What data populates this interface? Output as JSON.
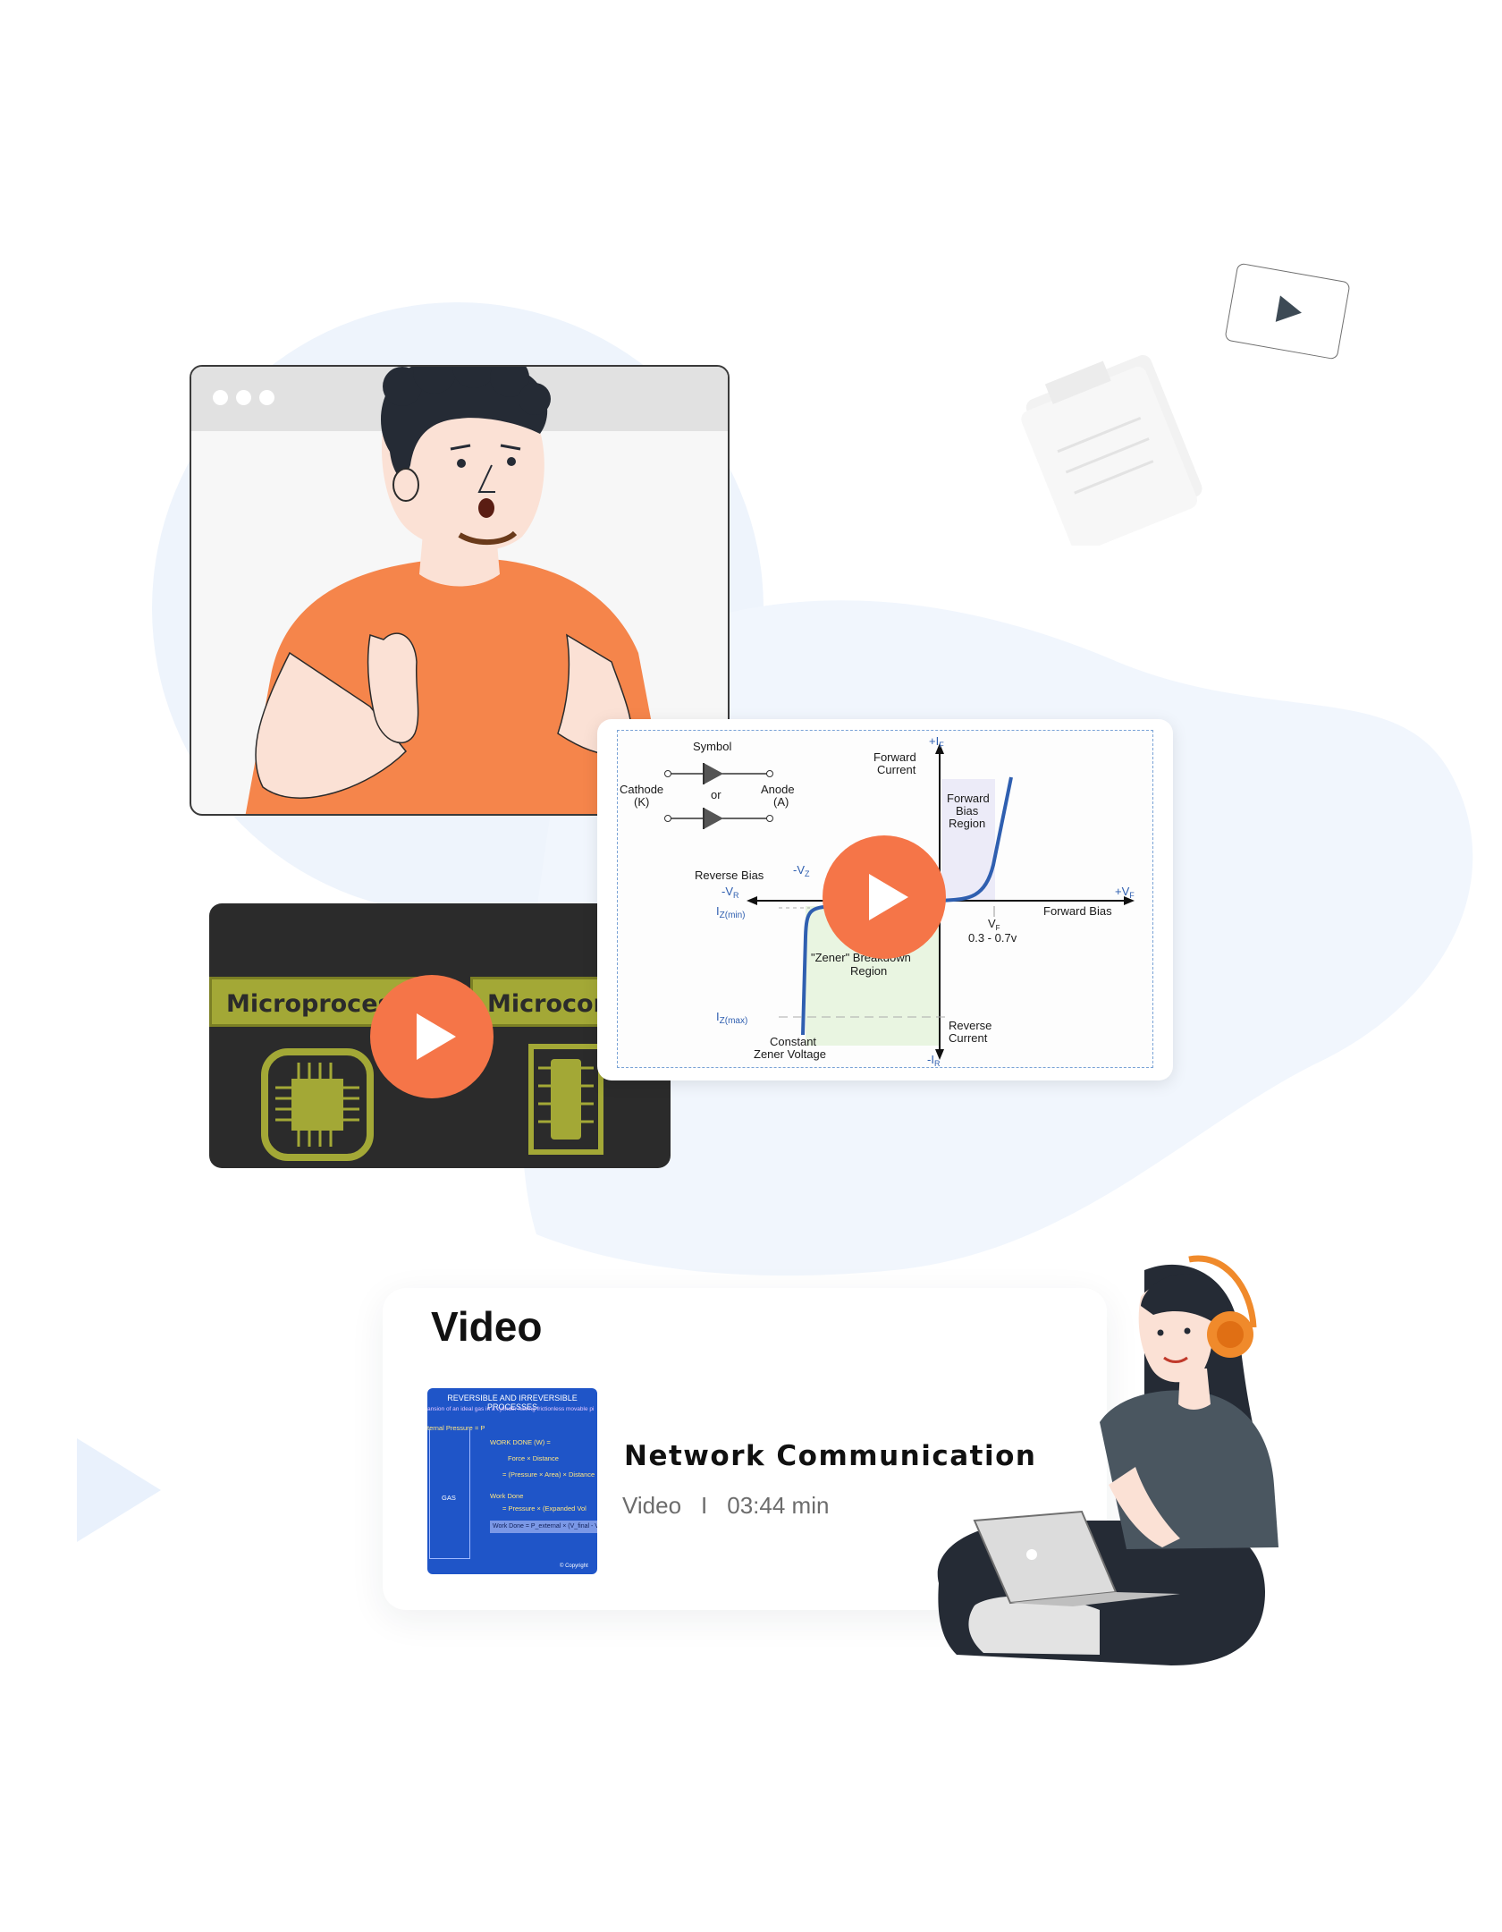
{
  "colors": {
    "accent": "#f57548",
    "blob": "#eef4fc",
    "dark_card": "#2b2b2b",
    "chip_green": "#a3a836",
    "thumbnail_blue": "#1f55c8"
  },
  "icons": {
    "play": "play-icon",
    "chip": "microchip-icon",
    "teacher": "teacher-illustration",
    "student": "student-with-headphones-illustration"
  },
  "dark_card": {
    "label_left": "Microprocess",
    "label_right": "Microcont"
  },
  "diagram": {
    "symbol": "Symbol",
    "or": "or",
    "cathode": "Cathode",
    "cathode_k": "(K)",
    "anode": "Anode",
    "anode_a": "(A)",
    "forward_current_1": "Forward",
    "forward_current_2": "Current",
    "plus_if": "+I",
    "plus_if_sub": "F",
    "forward_bias_region_1": "Forward",
    "forward_bias_region_2": "Bias",
    "forward_bias_region_3": "Region",
    "reverse_bias": "Reverse Bias",
    "minus_vr": "-V",
    "minus_vr_sub": "R",
    "minus_vz": "-V",
    "minus_vz_sub": "Z",
    "plus_vf": "+V",
    "plus_vf_sub": "F",
    "forward_bias": "Forward Bias",
    "iz_min": "I",
    "iz_min_sub": "Z(min)",
    "vf": "V",
    "vf_sub": "F",
    "vf_range": "0.3 - 0.7v",
    "zener_1": "\"Zener\" Breakdown",
    "zener_2": "Region",
    "iz_max": "I",
    "iz_max_sub": "Z(max)",
    "reverse_current_1": "Reverse",
    "reverse_current_2": "Current",
    "minus_ir": "-I",
    "minus_ir_sub": "R",
    "constant_1": "Constant",
    "constant_2": "Zener Voltage"
  },
  "video_section": {
    "heading": "Video",
    "item": {
      "title": "Network Communication",
      "type": "Video",
      "separator": "I",
      "duration": "03:44 min",
      "thumbnail": {
        "title": "REVERSIBLE AND IRREVERSIBLE PROCESSES",
        "subtitle": "ansion of an ideal gas in a cylinder having frictionless movable pi",
        "pressure": "ternal Pressure = P",
        "line1": "WORK DONE (W) =",
        "line2": "Force × Distance",
        "line3": "= (Pressure × Area) × Distance",
        "line4": "Work Done",
        "line5": "= Pressure × (Expanded Vol",
        "gas": "GAS",
        "formula": "Work Done = P_external × (V_final - V",
        "copyright": "© Copyright"
      }
    }
  }
}
